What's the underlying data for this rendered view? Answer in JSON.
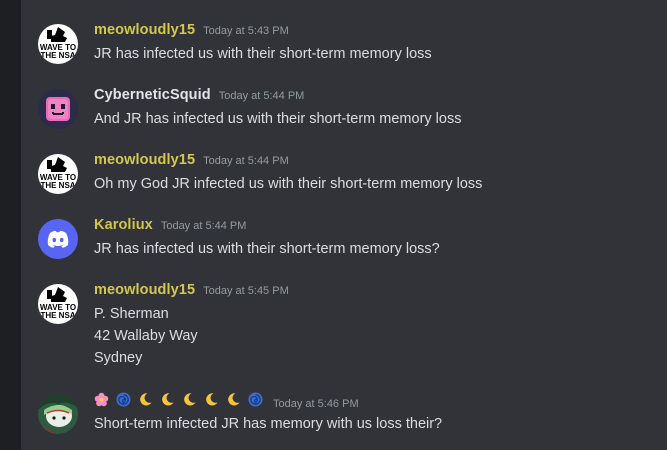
{
  "colors": {
    "meowloudly": "#d3c950",
    "cybernetic": "#e4e4e4",
    "karoliux": "#d1c64c",
    "text": "#dbdee1",
    "timestamp": "#949ba4",
    "background": "#313338"
  },
  "messages": [
    {
      "username": "meowloudly15",
      "timestamp": "Today at 5:43 PM",
      "avatar": "wave-to-the-nsa",
      "lines": [
        "JR has infected us with their short-term memory loss"
      ]
    },
    {
      "username": "CyberneticSquid",
      "timestamp": "Today at 5:44 PM",
      "avatar": "pink-pixel-face",
      "lines": [
        "And JR has infected us with their short-term memory loss"
      ]
    },
    {
      "username": "meowloudly15",
      "timestamp": "Today at 5:44 PM",
      "avatar": "wave-to-the-nsa",
      "lines": [
        "Oh my God JR infected us with their short-term memory loss"
      ]
    },
    {
      "username": "Karoliux",
      "timestamp": "Today at 5:44 PM",
      "avatar": "discord-default",
      "lines": [
        "JR has infected us with their short-term memory loss?"
      ]
    },
    {
      "username": "meowloudly15",
      "timestamp": "Today at 5:45 PM",
      "avatar": "wave-to-the-nsa",
      "lines": [
        "P. Sherman",
        "42 Wallaby Way",
        "Sydney"
      ]
    },
    {
      "username": "",
      "name_emojis": [
        "cherry-blossom",
        "cyclone",
        "crescent-moon",
        "crescent-moon",
        "crescent-moon",
        "crescent-moon",
        "crescent-moon",
        "cyclone"
      ],
      "timestamp": "Today at 5:46 PM",
      "avatar": "anime-green",
      "lines": [
        "Short-term infected JR has memory with us loss their?"
      ]
    }
  ],
  "avatar_text": {
    "wave_line1": "WAVE TO",
    "wave_line2": "THE NSA"
  }
}
